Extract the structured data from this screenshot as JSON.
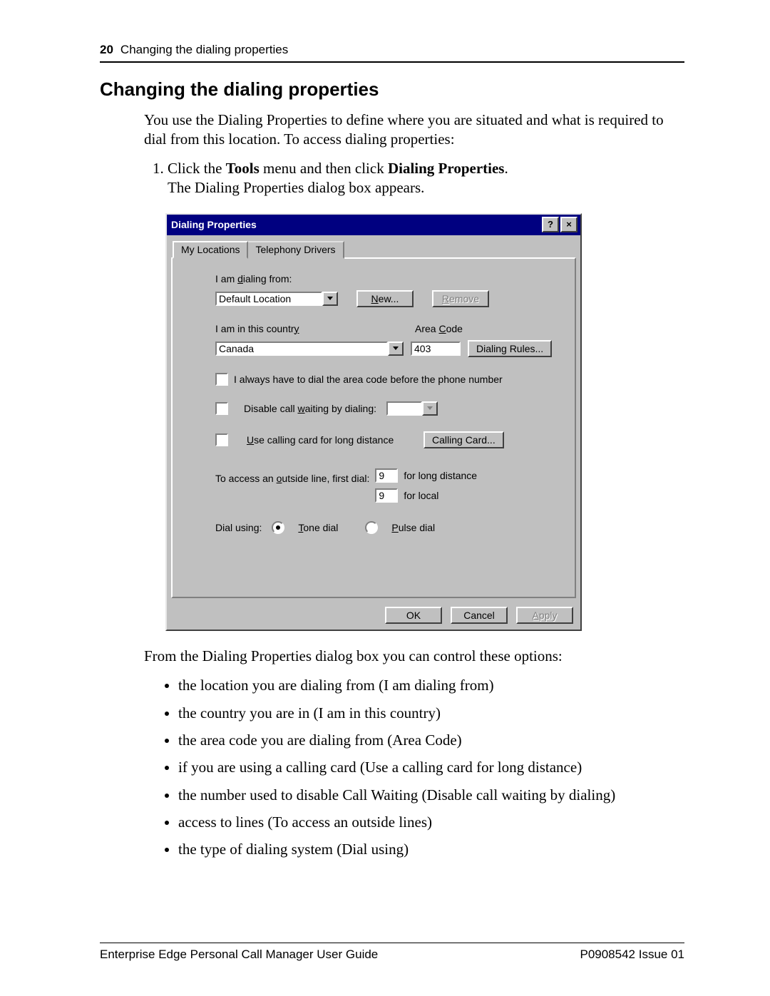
{
  "header": {
    "page_number": "20",
    "running_title": "Changing the dialing properties"
  },
  "section": {
    "title": "Changing the dialing properties",
    "intro": "You use the Dialing Properties to define where you are situated and what is required to dial from this location. To access dialing properties:",
    "step_prefix": "Click the ",
    "step_bold1": "Tools",
    "step_mid": " menu and then click ",
    "step_bold2": "Dialing Properties",
    "step_suffix": ".",
    "step_line2": "The Dialing Properties dialog box appears.",
    "after_dialog": "From the Dialing Properties dialog box you can control these options:",
    "bullets": [
      "the location you are dialing from (I am dialing from)",
      "the country you are in (I am in this country)",
      "the area code you are dialing from (Area Code)",
      "if you are using a calling card (Use a calling card for long distance)",
      "the number used to disable Call Waiting (Disable call waiting by dialing)",
      "access to lines (To access an outside lines)",
      "the type of dialing system (Dial using)"
    ]
  },
  "dialog": {
    "title": "Dialing Properties",
    "help_glyph": "?",
    "close_glyph": "×",
    "tabs": {
      "active": "My Locations",
      "other": "Telephony Drivers"
    },
    "labels": {
      "dialing_from": "I am dialing from:",
      "new_btn": "New...",
      "remove_btn": "Remove",
      "country": "I am in this country",
      "area_code": "Area Code",
      "dialing_rules": "Dialing Rules...",
      "always_areacode": "I always have to dial the area code before the phone number",
      "disable_cw": "Disable call waiting by dialing:",
      "use_calling_card": "Use calling card for long distance",
      "calling_card_btn": "Calling Card...",
      "outside_line": "To access an outside line, first dial:",
      "long_distance_suffix": "for long distance",
      "local_suffix": "for local",
      "dial_using": "Dial using:",
      "tone": "Tone dial",
      "pulse": "Pulse dial",
      "ok": "OK",
      "cancel": "Cancel",
      "apply": "Apply"
    },
    "values": {
      "location": "Default Location",
      "country_value": "Canada",
      "area_code_value": "403",
      "outside_long": "9",
      "outside_local": "9",
      "call_waiting_code": ""
    },
    "underlines": {
      "d": "d",
      "N": "N",
      "R": "R",
      "y": "y",
      "C": "C",
      "w": "w",
      "U": "U",
      "o": "o",
      "T": "T",
      "P": "P",
      "A": "A"
    }
  },
  "footer": {
    "left": "Enterprise Edge Personal Call Manager User Guide",
    "right": "P0908542 Issue 01"
  }
}
